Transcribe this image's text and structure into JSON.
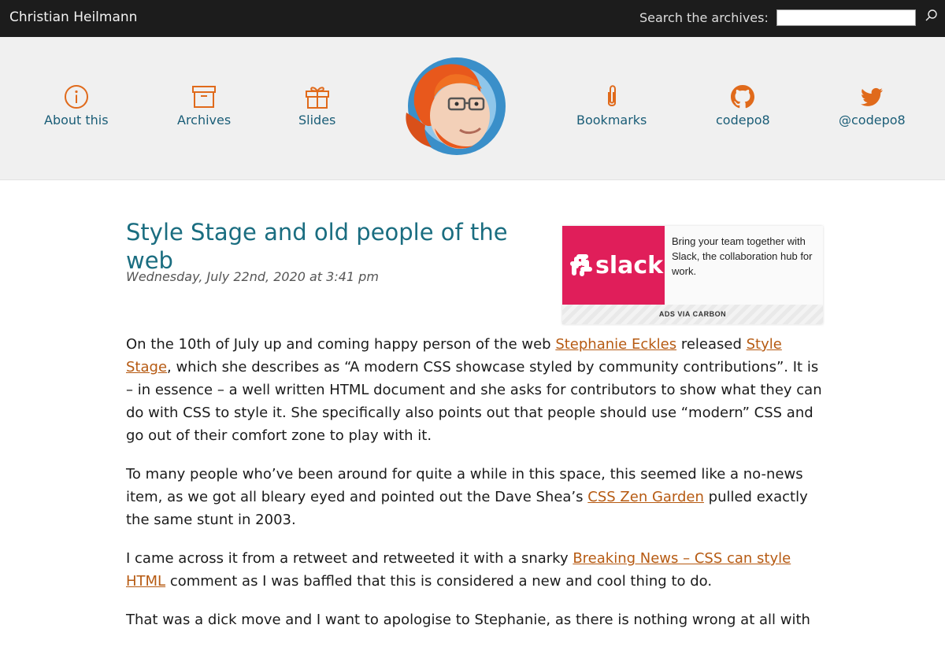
{
  "header": {
    "site_title": "Christian Heilmann",
    "search_label": "Search the archives:",
    "search_value": "",
    "search_icon": "search-icon"
  },
  "nav": {
    "about": {
      "label": "About this",
      "icon": "info-icon"
    },
    "archives": {
      "label": "Archives",
      "icon": "archive-box-icon"
    },
    "slides": {
      "label": "Slides",
      "icon": "gift-icon"
    },
    "bookmarks": {
      "label": "Bookmarks",
      "icon": "paperclip-icon"
    },
    "github": {
      "label": "codepo8",
      "icon": "github-icon"
    },
    "twitter": {
      "label": "@codepo8",
      "icon": "twitter-icon"
    },
    "accent_color": "#e06a1b",
    "link_color": "#1a5d77"
  },
  "post": {
    "title": "Style Stage and old people of the web",
    "date": "Wednesday, July 22nd, 2020 at 3:41 pm",
    "p1": {
      "t1": "On the 10th of July up and coming happy person of the web ",
      "l1": "Stephanie Eckles",
      "t2": " released ",
      "l2": "Style Stage",
      "t3": ", which she describes as “A modern CSS showcase styled by community contributions”. It is – in essence – a well written HTML document and she asks for contributors to show what they can do with CSS to style it. She specifically also points out that people should use “modern” CSS and go out of their comfort zone to play with it."
    },
    "p2": {
      "t1": "To many people who’ve been around for quite a while in this space, this seemed like a no-news item, as we got all bleary eyed and pointed out the Dave Shea’s ",
      "l1": "CSS Zen Garden",
      "t2": " pulled exactly the same stunt in 2003."
    },
    "p3": {
      "t1": "I came across it from a retweet and retweeted it with a snarky ",
      "l1": "Breaking News – CSS can style HTML",
      "t2": " comment as I was baffled that this is considered a new and cool thing to do."
    },
    "p4": {
      "t1": "That was a dick move and I want to apologise to Stephanie, as there is nothing wrong at all with"
    },
    "title_color": "#1a6d80",
    "link_color": "#b65a12"
  },
  "ad": {
    "logo_text": "slack",
    "text": "Bring your team together with Slack, the collaboration hub for work.",
    "via": "ADS VIA CARBON",
    "brand_color": "#e01e5a"
  }
}
